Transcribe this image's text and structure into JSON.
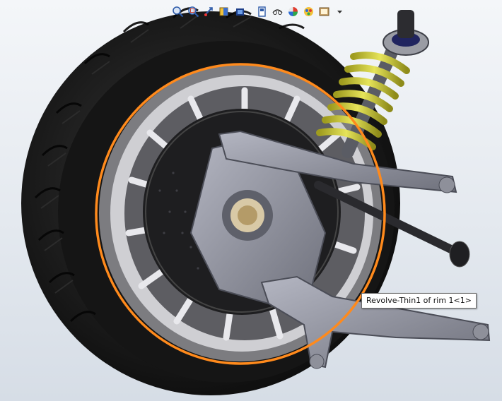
{
  "heads_up_toolbar": {
    "buttons": [
      {
        "name": "zoom-to-fit-icon"
      },
      {
        "name": "zoom-to-area-icon"
      },
      {
        "name": "previous-view-icon"
      },
      {
        "name": "section-view-icon"
      },
      {
        "name": "dynamic-annotation-view-icon"
      },
      {
        "name": "view-orientation-icon"
      },
      {
        "name": "display-style-icon"
      },
      {
        "name": "hide-show-items-icon"
      },
      {
        "name": "edit-appearance-icon"
      },
      {
        "name": "apply-scene-icon"
      },
      {
        "name": "view-settings-icon"
      }
    ]
  },
  "tooltip": {
    "text": "Revolve-Thin1 of rim 1<1>"
  },
  "colors": {
    "selection_highlight": "#ff8a1c",
    "spring": "#d6d43a",
    "tire": "#1b1b1b",
    "metal": "#8d8f99"
  }
}
